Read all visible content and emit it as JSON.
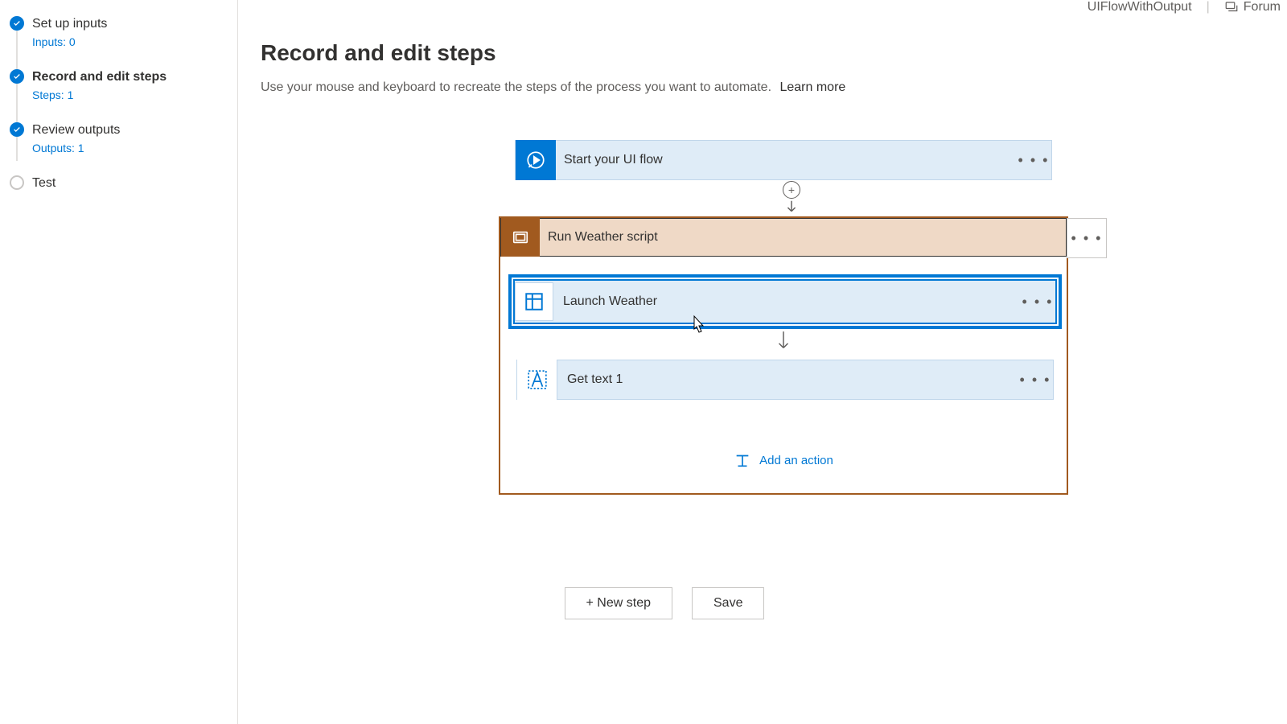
{
  "header": {
    "flow_name": "UIFlowWithOutput",
    "forum": "Forum"
  },
  "sidebar": {
    "items": [
      {
        "title": "Set up inputs",
        "sub": "Inputs: 0"
      },
      {
        "title": "Record and edit steps",
        "sub": "Steps: 1"
      },
      {
        "title": "Review outputs",
        "sub": "Outputs: 1"
      },
      {
        "title": "Test"
      }
    ]
  },
  "page": {
    "title": "Record and edit steps",
    "desc": "Use your mouse and keyboard to recreate the steps of the process you want to automate.",
    "learn_more": "Learn more"
  },
  "flow": {
    "start_label": "Start your UI flow",
    "group_label": "Run Weather script",
    "launch_label": "Launch Weather",
    "gettext_label": "Get text 1",
    "add_action": "Add an action"
  },
  "buttons": {
    "new_step": "+ New step",
    "save": "Save"
  },
  "ellipsis": "• • •"
}
